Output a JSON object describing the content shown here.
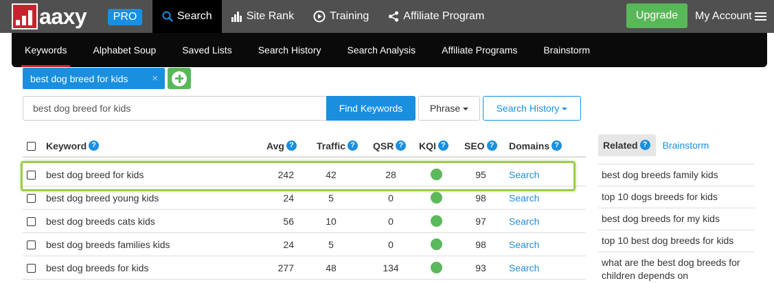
{
  "app": {
    "logo_text": "aaxy",
    "badge": "PRO"
  },
  "topnav": {
    "items": [
      {
        "label": "Search",
        "icon": "search-icon"
      },
      {
        "label": "Site Rank",
        "icon": "bar-chart-icon"
      },
      {
        "label": "Training",
        "icon": "play-circle-icon"
      },
      {
        "label": "Affiliate Program",
        "icon": "share-icon"
      }
    ],
    "active": "Search",
    "upgrade_label": "Upgrade",
    "account_label": "My Account"
  },
  "subnav": {
    "items": [
      "Keywords",
      "Alphabet Soup",
      "Saved Lists",
      "Search History",
      "Search Analysis",
      "Affiliate Programs",
      "Brainstorm"
    ],
    "active": "Keywords"
  },
  "tag": {
    "label": "best dog breed for kids",
    "close": "×"
  },
  "search": {
    "value": "best dog breed for kids",
    "find_label": "Find Keywords",
    "phrase_label": "Phrase",
    "history_label": "Search History"
  },
  "table": {
    "headers": {
      "keyword": "Keyword",
      "avg": "Avg",
      "traffic": "Traffic",
      "qsr": "QSR",
      "kqi": "KQI",
      "seo": "SEO",
      "domains": "Domains"
    },
    "help": "?",
    "rows": [
      {
        "keyword": "best dog breed for kids",
        "avg": "242",
        "traffic": "42",
        "qsr": "28",
        "kqi": "green",
        "seo": "95",
        "domains": "Search"
      },
      {
        "keyword": "best dog breed young kids",
        "avg": "24",
        "traffic": "5",
        "qsr": "0",
        "kqi": "green",
        "seo": "98",
        "domains": "Search"
      },
      {
        "keyword": "best dog breeds cats kids",
        "avg": "56",
        "traffic": "10",
        "qsr": "0",
        "kqi": "green",
        "seo": "97",
        "domains": "Search"
      },
      {
        "keyword": "best dog breeds families kids",
        "avg": "24",
        "traffic": "5",
        "qsr": "0",
        "kqi": "green",
        "seo": "98",
        "domains": "Search"
      },
      {
        "keyword": "best dog breeds for kids",
        "avg": "277",
        "traffic": "48",
        "qsr": "134",
        "kqi": "green",
        "seo": "93",
        "domains": "Search"
      }
    ]
  },
  "related": {
    "tab_related": "Related",
    "tab_brainstorm": "Brainstorm",
    "items": [
      "best dog breeds family kids",
      "top 10 dogs breeds for kids",
      "best dog breeds for my kids",
      "top 10 best dog breeds for kids",
      "what are the best dog breeds for children depends on"
    ]
  },
  "colors": {
    "topbar": "#505050",
    "subnav": "#0a0a0a",
    "accent_blue": "#1a8fe0",
    "green": "#58b858",
    "brand_red": "#c8232c",
    "highlight": "#9ccc4a"
  }
}
